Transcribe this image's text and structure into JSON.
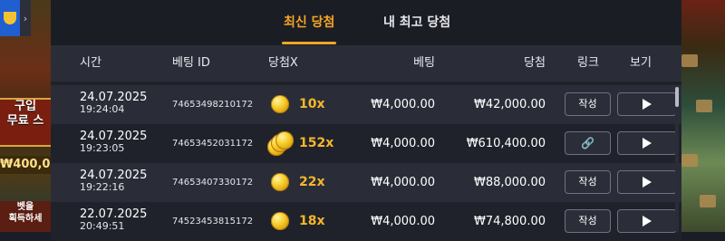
{
  "left_promo": {
    "line1": "구입",
    "line2": "무료 스",
    "amount": "₩400,0",
    "line3": "벳을",
    "line4": "획득하세"
  },
  "tabs": [
    {
      "label": "최신 당첨",
      "active": true
    },
    {
      "label": "내 최고 당첨",
      "active": false
    }
  ],
  "columns": {
    "time": "시간",
    "bet_id": "베팅 ID",
    "multiplier": "당첨X",
    "bet": "베팅",
    "win": "당첨",
    "link": "링크",
    "view": "보기"
  },
  "rows": [
    {
      "date": "24.07.2025",
      "time": "19:24:04",
      "bet_id": "74653498210172",
      "multiplier": "10x",
      "coins": 1,
      "bet": "₩4,000.00",
      "win": "₩42,000.00",
      "link_label": "작성",
      "link_icon": "none"
    },
    {
      "date": "24.07.2025",
      "time": "19:23:05",
      "bet_id": "74653452031172",
      "multiplier": "152x",
      "coins": 3,
      "bet": "₩4,000.00",
      "win": "₩610,400.00",
      "link_label": "",
      "link_icon": "chain-link-icon"
    },
    {
      "date": "24.07.2025",
      "time": "19:22:16",
      "bet_id": "74653407330172",
      "multiplier": "22x",
      "coins": 1,
      "bet": "₩4,000.00",
      "win": "₩88,000.00",
      "link_label": "작성",
      "link_icon": "none"
    },
    {
      "date": "22.07.2025",
      "time": "20:49:51",
      "bet_id": "74523453815172",
      "multiplier": "18x",
      "coins": 1,
      "bet": "₩4,000.00",
      "win": "₩74,800.00",
      "link_label": "작성",
      "link_icon": "none"
    }
  ],
  "colors": {
    "accent": "#f5a623",
    "multiplier": "#f5b72a",
    "panel": "#1f2129",
    "row_alt": "#2a2d38"
  },
  "glyphs": {
    "chain": "🔗",
    "chevron": "›"
  }
}
